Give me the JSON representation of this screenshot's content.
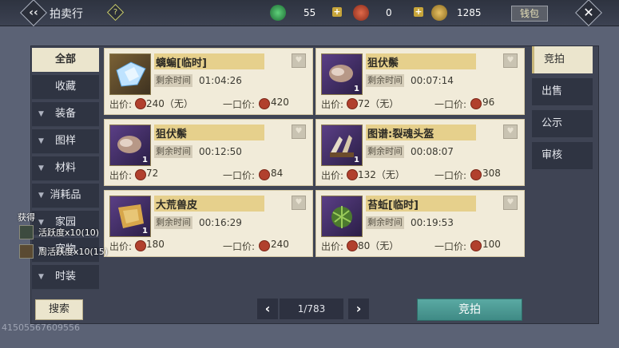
{
  "header": {
    "title": "拍卖行",
    "currency_jade": "55",
    "currency_red": "0",
    "currency_gold": "1285",
    "wallet_label": "钱包"
  },
  "left_nav": [
    {
      "label": "全部",
      "active": true
    },
    {
      "label": "收藏"
    },
    {
      "label": "装备"
    },
    {
      "label": "图样"
    },
    {
      "label": "材料"
    },
    {
      "label": "消耗品"
    },
    {
      "label": "家园"
    },
    {
      "label": "宠物"
    },
    {
      "label": "时装"
    }
  ],
  "right_tabs": [
    "竞拍",
    "出售",
    "公示",
    "审核"
  ],
  "items": [
    {
      "name": "螭蝙[临时]",
      "time_label": "剩余时间",
      "time": "01:04:26",
      "bid_label": "出价:",
      "bid": "240（无）",
      "bo_label": "一口价:",
      "bo": "420",
      "qty": ""
    },
    {
      "name": "狙伏鬃",
      "time_label": "剩余时间",
      "time": "00:07:14",
      "bid_label": "出价:",
      "bid": "72（无）",
      "bo_label": "一口价:",
      "bo": "96",
      "qty": "1"
    },
    {
      "name": "狙伏鬃",
      "time_label": "剩余时间",
      "time": "00:12:50",
      "bid_label": "出价:",
      "bid": "72",
      "bo_label": "一口价:",
      "bo": "84",
      "qty": "1"
    },
    {
      "name": "图谱:裂魂头盔",
      "time_label": "剩余时间",
      "time": "00:08:07",
      "bid_label": "出价:",
      "bid": "132（无）",
      "bo_label": "一口价:",
      "bo": "308",
      "qty": "1"
    },
    {
      "name": "大荒兽皮",
      "time_label": "剩余时间",
      "time": "00:16:29",
      "bid_label": "出价:",
      "bid": "180",
      "bo_label": "一口价:",
      "bo": "240",
      "qty": "1"
    },
    {
      "name": "苔蚯[临时]",
      "time_label": "剩余时间",
      "time": "00:19:53",
      "bid_label": "出价:",
      "bid": "80（无）",
      "bo_label": "一口价:",
      "bo": "100",
      "qty": ""
    }
  ],
  "bottom": {
    "search": "搜索",
    "page": "1/783",
    "bid_button": "竞拍"
  },
  "rewards": {
    "title": "获得",
    "items": [
      "活跃度x10(10)",
      "周活跃度x10(15)"
    ]
  },
  "footer_id": "41505567609556",
  "colors": {
    "accent_teal": "#4f9b96",
    "card_bg": "#f1ebd9",
    "name_bar": "#e6d08c"
  }
}
